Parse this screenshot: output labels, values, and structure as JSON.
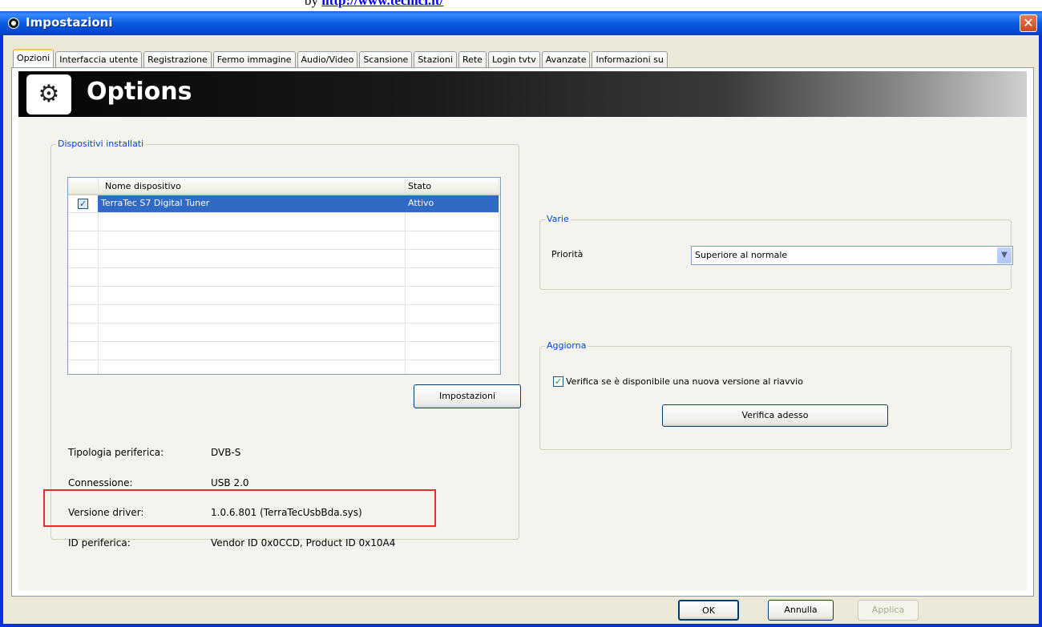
{
  "top_note": {
    "prefix": "by",
    "link": "http://www.tecnici.it/"
  },
  "window": {
    "title": "Impostazioni"
  },
  "tabs": [
    "Opzioni",
    "Interfaccia utente",
    "Registrazione",
    "Fermo immagine",
    "Audio/Video",
    "Scansione",
    "Stazioni",
    "Rete",
    "Login tvtv",
    "Avanzate",
    "Informazioni su"
  ],
  "banner": {
    "title": "Options",
    "icon": "gears-icon"
  },
  "devices": {
    "legend": "Dispositivi installati",
    "columns": [
      "Nome dispositivo",
      "Stato"
    ],
    "rows": [
      {
        "checked": true,
        "name": "TerraTec S7 Digital Tuner",
        "status": "Attivo"
      }
    ],
    "settings_button": "Impostazioni"
  },
  "device_info": [
    {
      "label": "Tipologia periferica:",
      "value": "DVB-S"
    },
    {
      "label": "Connessione:",
      "value": "USB 2.0"
    },
    {
      "label": "Versione driver:",
      "value": "1.0.6.801 (TerraTecUsbBda.sys)"
    },
    {
      "label": "ID periferica:",
      "value": "Vendor ID 0x0CCD, Product ID 0x10A4"
    }
  ],
  "highlight_color": "#e03030",
  "varie": {
    "legend": "Varie",
    "priority_label": "Priorità",
    "priority_value": "Superiore al normale"
  },
  "aggiorna": {
    "legend": "Aggiorna",
    "check_label": "Verifica se è disponibile una nuova versione al riavvio",
    "checked": true,
    "button": "Verifica adesso"
  },
  "footer": {
    "ok": "OK",
    "cancel": "Annulla",
    "apply": "Applica"
  }
}
